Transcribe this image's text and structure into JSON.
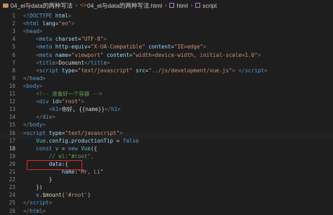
{
  "breadcrumb": {
    "folder": "04_el与data的两种写法",
    "file": "04_el与data的两种写法.html",
    "node1": "html",
    "node2": "script"
  },
  "lines": [
    {
      "n": "1",
      "tokens": [
        [
          "t-punc",
          "<"
        ],
        [
          "t-tag",
          "!DOCTYPE"
        ],
        [
          "t-text",
          " "
        ],
        [
          "t-attr",
          "html"
        ],
        [
          "t-punc",
          ">"
        ]
      ]
    },
    {
      "n": "2",
      "tokens": [
        [
          "t-punc",
          "<"
        ],
        [
          "t-tag",
          "html"
        ],
        [
          "t-text",
          " "
        ],
        [
          "t-attr",
          "lang"
        ],
        [
          "t-text",
          "="
        ],
        [
          "t-str",
          "\"en\""
        ],
        [
          "t-punc",
          ">"
        ]
      ]
    },
    {
      "n": "3",
      "tokens": [
        [
          "t-punc",
          "<"
        ],
        [
          "t-tag",
          "head"
        ],
        [
          "t-punc",
          ">"
        ]
      ]
    },
    {
      "n": "4",
      "tokens": [
        [
          "t-text",
          "    "
        ],
        [
          "t-punc",
          "<"
        ],
        [
          "t-tag",
          "meta"
        ],
        [
          "t-text",
          " "
        ],
        [
          "t-attr",
          "charset"
        ],
        [
          "t-text",
          "="
        ],
        [
          "t-str",
          "\"UTF-8\""
        ],
        [
          "t-punc",
          ">"
        ]
      ]
    },
    {
      "n": "5",
      "tokens": [
        [
          "t-text",
          "    "
        ],
        [
          "t-punc",
          "<"
        ],
        [
          "t-tag",
          "meta"
        ],
        [
          "t-text",
          " "
        ],
        [
          "t-attr",
          "http-equiv"
        ],
        [
          "t-text",
          "="
        ],
        [
          "t-str",
          "\"X-UA-Compatible\""
        ],
        [
          "t-text",
          " "
        ],
        [
          "t-attr",
          "content"
        ],
        [
          "t-text",
          "="
        ],
        [
          "t-str",
          "\"IE=edge\""
        ],
        [
          "t-punc",
          ">"
        ]
      ]
    },
    {
      "n": "6",
      "tokens": [
        [
          "t-text",
          "    "
        ],
        [
          "t-punc",
          "<"
        ],
        [
          "t-tag",
          "meta"
        ],
        [
          "t-text",
          " "
        ],
        [
          "t-attr",
          "name"
        ],
        [
          "t-text",
          "="
        ],
        [
          "t-str",
          "\"viewport\""
        ],
        [
          "t-text",
          " "
        ],
        [
          "t-attr",
          "content"
        ],
        [
          "t-text",
          "="
        ],
        [
          "t-str",
          "\"width=device-width, initial-scale=1.0\""
        ],
        [
          "t-punc",
          ">"
        ]
      ]
    },
    {
      "n": "7",
      "tokens": [
        [
          "t-text",
          "    "
        ],
        [
          "t-punc",
          "<"
        ],
        [
          "t-tag",
          "title"
        ],
        [
          "t-punc",
          ">"
        ],
        [
          "t-text",
          "Document"
        ],
        [
          "t-punc",
          "</"
        ],
        [
          "t-tag",
          "title"
        ],
        [
          "t-punc",
          ">"
        ]
      ]
    },
    {
      "n": "8",
      "tokens": [
        [
          "t-text",
          "    "
        ],
        [
          "t-punc",
          "<"
        ],
        [
          "t-tag",
          "script"
        ],
        [
          "t-text",
          " "
        ],
        [
          "t-attr",
          "type"
        ],
        [
          "t-text",
          "="
        ],
        [
          "t-str",
          "\"text/javascript\""
        ],
        [
          "t-text",
          " "
        ],
        [
          "t-attr",
          "src"
        ],
        [
          "t-text",
          "="
        ],
        [
          "t-str",
          "\"../js/development/vue.js\""
        ],
        [
          "t-punc",
          ">"
        ],
        [
          "t-text",
          " "
        ],
        [
          "t-punc",
          "</"
        ],
        [
          "t-tag",
          "script"
        ],
        [
          "t-punc",
          ">"
        ]
      ]
    },
    {
      "n": "9",
      "tokens": [
        [
          "t-punc",
          "</"
        ],
        [
          "t-tag",
          "head"
        ],
        [
          "t-punc",
          ">"
        ]
      ]
    },
    {
      "n": "10",
      "tokens": [
        [
          "t-punc",
          "<"
        ],
        [
          "t-tag",
          "body"
        ],
        [
          "t-punc",
          ">"
        ]
      ]
    },
    {
      "n": "11",
      "tokens": [
        [
          "t-text",
          "    "
        ],
        [
          "t-comment",
          "<!-- 准备好一个容器 -->"
        ]
      ]
    },
    {
      "n": "12",
      "tokens": [
        [
          "t-text",
          "    "
        ],
        [
          "t-punc",
          "<"
        ],
        [
          "t-tag",
          "div"
        ],
        [
          "t-text",
          " "
        ],
        [
          "t-attr",
          "id"
        ],
        [
          "t-text",
          "="
        ],
        [
          "t-str",
          "\"root\""
        ],
        [
          "t-punc",
          ">"
        ]
      ]
    },
    {
      "n": "13",
      "tokens": [
        [
          "t-text",
          "        "
        ],
        [
          "t-punc",
          "<"
        ],
        [
          "t-tag",
          "h1"
        ],
        [
          "t-punc",
          ">"
        ],
        [
          "t-text",
          "你好, {{name}}"
        ],
        [
          "t-punc",
          "</"
        ],
        [
          "t-tag",
          "h1"
        ],
        [
          "t-punc",
          ">"
        ]
      ]
    },
    {
      "n": "14",
      "tokens": [
        [
          "t-text",
          "    "
        ],
        [
          "t-punc",
          "</"
        ],
        [
          "t-tag",
          "div"
        ],
        [
          "t-punc",
          ">"
        ]
      ]
    },
    {
      "n": "15",
      "tokens": [
        [
          "t-punc",
          "</"
        ],
        [
          "t-tag",
          "body"
        ],
        [
          "t-punc",
          ">"
        ]
      ]
    },
    {
      "n": "16",
      "tokens": [
        [
          "t-punc",
          "<"
        ],
        [
          "t-tag",
          "script"
        ],
        [
          "t-text",
          " "
        ],
        [
          "t-attr",
          "type"
        ],
        [
          "t-text",
          "="
        ],
        [
          "t-str",
          "\"text/javascript\""
        ],
        [
          "t-punc",
          ">"
        ]
      ]
    },
    {
      "n": "17",
      "tokens": [
        [
          "t-text",
          "    "
        ],
        [
          "t-class",
          "Vue"
        ],
        [
          "t-text",
          "."
        ],
        [
          "t-prop",
          "config"
        ],
        [
          "t-text",
          "."
        ],
        [
          "t-prop",
          "productionTip"
        ],
        [
          "t-op",
          " = "
        ],
        [
          "t-bool",
          "false"
        ]
      ]
    },
    {
      "n": "18",
      "tokens": [
        [
          "t-text",
          "    "
        ],
        [
          "t-kw",
          "const"
        ],
        [
          "t-text",
          " "
        ],
        [
          "t-var",
          "v"
        ],
        [
          "t-op",
          " = "
        ],
        [
          "t-kw",
          "new"
        ],
        [
          "t-text",
          " "
        ],
        [
          "t-class",
          "Vue"
        ],
        [
          "t-text",
          "({"
        ]
      ]
    },
    {
      "n": "19",
      "tokens": [
        [
          "t-text",
          "        "
        ],
        [
          "t-comment",
          "// el:\"#root\","
        ]
      ]
    },
    {
      "n": "20",
      "tokens": [
        [
          "t-text",
          "        "
        ],
        [
          "t-prop",
          "data"
        ],
        [
          "t-text",
          ":{"
        ]
      ]
    },
    {
      "n": "21",
      "tokens": [
        [
          "t-text",
          "            "
        ],
        [
          "t-prop",
          "name"
        ],
        [
          "t-text",
          ":"
        ],
        [
          "t-str",
          "\"Mr, Li\""
        ]
      ]
    },
    {
      "n": "22",
      "tokens": [
        [
          "t-text",
          "        "
        ],
        [
          "t-text",
          "}"
        ]
      ]
    },
    {
      "n": "23",
      "tokens": [
        [
          "t-text",
          "    "
        ],
        [
          "t-text",
          "})"
        ]
      ]
    },
    {
      "n": "24",
      "tokens": [
        [
          "t-text",
          "    "
        ],
        [
          "t-var",
          "v"
        ],
        [
          "t-text",
          "."
        ],
        [
          "t-func",
          "$mount"
        ],
        [
          "t-text",
          "("
        ],
        [
          "t-str",
          "'#root'"
        ],
        [
          "t-text",
          ")"
        ]
      ]
    },
    {
      "n": "25",
      "tokens": [
        [
          "t-punc",
          "</"
        ],
        [
          "t-tag",
          "script"
        ],
        [
          "t-punc",
          ">"
        ]
      ]
    },
    {
      "n": "26",
      "tokens": [
        [
          "t-punc",
          "</"
        ],
        [
          "t-tag",
          "html"
        ],
        [
          "t-punc",
          ">"
        ]
      ]
    }
  ]
}
